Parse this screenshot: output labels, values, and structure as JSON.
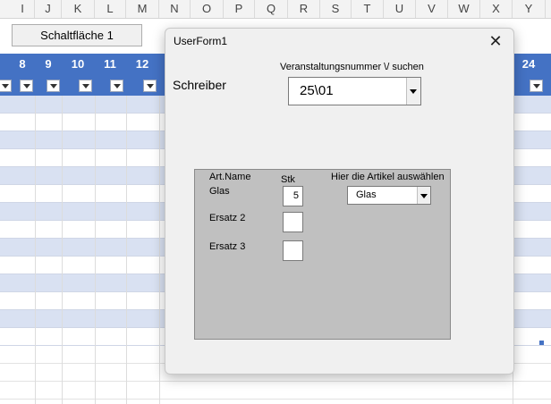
{
  "sheet": {
    "columns": [
      "I",
      "J",
      "K",
      "L",
      "M",
      "N",
      "O",
      "P",
      "Q",
      "R",
      "S",
      "T",
      "U",
      "V",
      "W",
      "X",
      "Y"
    ],
    "band_left": [
      "8",
      "9",
      "10",
      "11",
      "12"
    ],
    "band_right": "24",
    "button_label": "Schaltfläche 1"
  },
  "dialog": {
    "title": "UserForm1",
    "close_glyph": "✕",
    "schreiber_label": "Schreiber",
    "veranstaltung_label": "Veranstaltungsnummer \\/ suchen",
    "veranstaltung_value": "25\\01",
    "frame": {
      "col_name": "Art.Name",
      "col_stk": "Stk",
      "col_select": "Hier die Artikel auswählen",
      "rows": [
        {
          "name": "Glas",
          "qty": "5"
        },
        {
          "name": "Ersatz 2",
          "qty": ""
        },
        {
          "name": "Ersatz 3",
          "qty": ""
        }
      ],
      "article_value": "Glas"
    }
  },
  "colors": {
    "header_band": "#4472c4",
    "row_stripe": "#d9e1f2"
  }
}
